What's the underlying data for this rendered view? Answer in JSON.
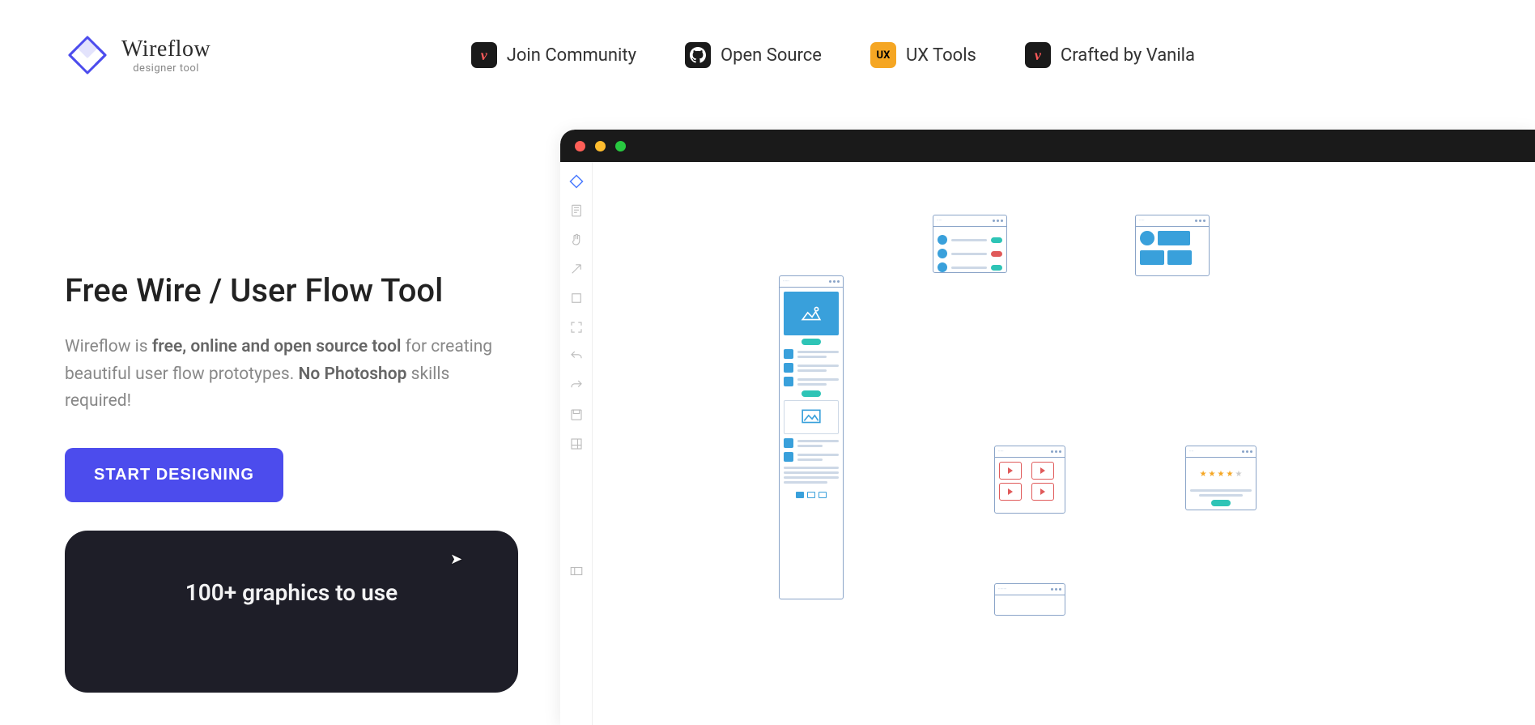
{
  "logo": {
    "title": "Wireflow",
    "subtitle": "designer tool"
  },
  "nav": {
    "community": "Join Community",
    "opensource": "Open Source",
    "uxtools": "UX Tools",
    "crafted": "Crafted by Vanila",
    "ux_badge": "UX"
  },
  "hero": {
    "title": "Free Wire / User Flow Tool",
    "desc_pre": "Wireflow is ",
    "desc_bold1": "free, online and open source tool",
    "desc_mid": " for creating beautiful user flow prototypes. ",
    "desc_bold2": "No Photoshop",
    "desc_post": " skills required!",
    "cta": "START DESIGNING"
  },
  "feature": {
    "title": "100+ graphics to use"
  },
  "colors": {
    "primary": "#4c4ced",
    "dark": "#1e1e28",
    "accent": "#39a0db"
  }
}
